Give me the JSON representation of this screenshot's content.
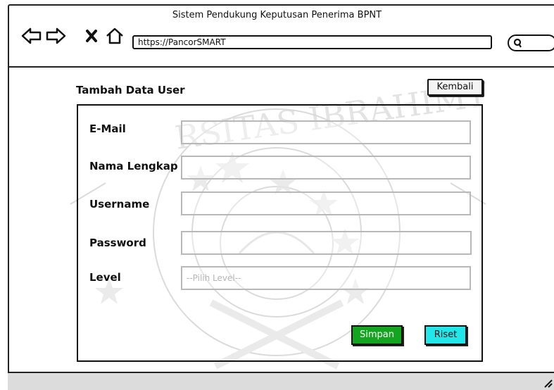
{
  "window": {
    "title": "Sistem Pendukung Keputusan Penerima BPNT"
  },
  "toolbar": {
    "back_icon": "arrow-left-icon",
    "forward_icon": "arrow-right-icon",
    "stop_icon": "close-icon",
    "home_icon": "home-icon",
    "url": "https://PancorSMART",
    "search_icon": "search-icon"
  },
  "page": {
    "title": "Tambah Data User",
    "back_label": "Kembali"
  },
  "form": {
    "fields": [
      {
        "label": "E-Mail",
        "value": ""
      },
      {
        "label": "Nama Lengkap",
        "value": ""
      },
      {
        "label": "Username",
        "value": ""
      },
      {
        "label": "Password",
        "value": ""
      },
      {
        "label": "Level",
        "placeholder": "--Pilih Level--"
      }
    ],
    "save_label": "Simpan",
    "reset_label": "Riset",
    "save_color": "#13a51f",
    "reset_color": "#21e6ea"
  }
}
